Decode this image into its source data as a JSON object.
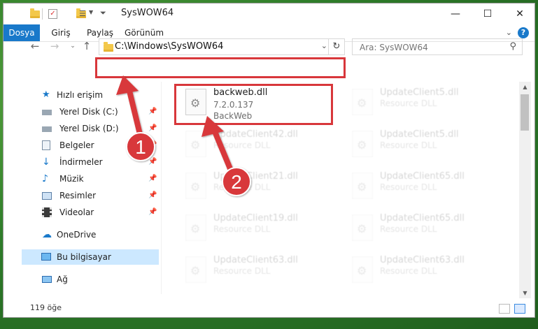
{
  "window": {
    "title": "SysWOW64",
    "controls": {
      "minimize": "—",
      "maximize": "☐",
      "close": "✕"
    }
  },
  "ribbon": {
    "tabs": [
      "Dosya",
      "Giriş",
      "Paylaş",
      "Görünüm"
    ],
    "help": "?"
  },
  "address": {
    "path": "C:\\Windows\\SysWOW64"
  },
  "search": {
    "placeholder": "Ara: SysWOW64"
  },
  "sidebar": {
    "items": [
      {
        "label": "Hızlı erişim",
        "icon": "star-icon",
        "pinned": false
      },
      {
        "label": "Yerel Disk (C:)",
        "icon": "drive-icon",
        "pinned": true
      },
      {
        "label": "Yerel Disk (D:)",
        "icon": "drive-icon",
        "pinned": true
      },
      {
        "label": "Belgeler",
        "icon": "documents-icon",
        "pinned": true
      },
      {
        "label": "İndirmeler",
        "icon": "download-icon",
        "pinned": true
      },
      {
        "label": "Müzik",
        "icon": "music-icon",
        "pinned": true
      },
      {
        "label": "Resimler",
        "icon": "pictures-icon",
        "pinned": true
      },
      {
        "label": "Videolar",
        "icon": "videos-icon",
        "pinned": true
      },
      {
        "label": "OneDrive",
        "icon": "cloud-icon",
        "pinned": false
      },
      {
        "label": "Bu bilgisayar",
        "icon": "computer-icon",
        "pinned": false,
        "selected": true
      },
      {
        "label": "Ağ",
        "icon": "network-icon",
        "pinned": false
      }
    ]
  },
  "files": {
    "highlighted": {
      "name": "backweb.dll",
      "version": "7.2.0.137",
      "description": "BackWeb"
    },
    "others": [
      {
        "name": "UpdateClient5.dll",
        "type": "Resource DLL"
      },
      {
        "name": "UpdateClient42.dll",
        "type": "Resource DLL"
      },
      {
        "name": "UpdateClient5.dll",
        "type": "Resource DLL"
      },
      {
        "name": "UpdateClient21.dll",
        "type": "Resource DLL"
      },
      {
        "name": "UpdateClient65.dll",
        "type": "Resource DLL"
      },
      {
        "name": "UpdateClient19.dll",
        "type": "Resource DLL"
      },
      {
        "name": "UpdateClient65.dll",
        "type": "Resource DLL"
      },
      {
        "name": "UpdateClient63.dll",
        "type": "Resource DLL"
      },
      {
        "name": "UpdateClient63.dll",
        "type": "Resource DLL"
      }
    ]
  },
  "status": {
    "count": "119 öğe"
  },
  "annotations": {
    "step1": "1",
    "step2": "2",
    "color": "#d8373b"
  }
}
